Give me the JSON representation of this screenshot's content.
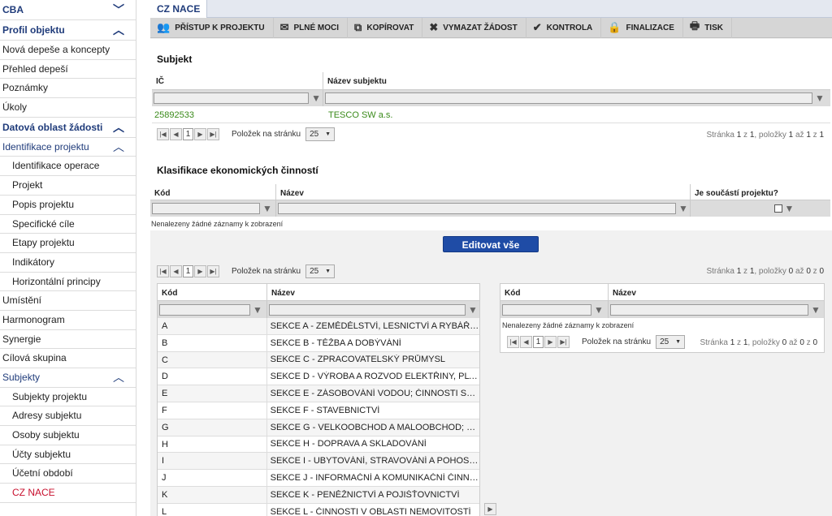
{
  "sidebar": {
    "items": [
      {
        "label": "CBA",
        "type": "header",
        "chevron": "﹀"
      },
      {
        "label": "Profil objektu",
        "type": "header",
        "chevron": "︿"
      },
      {
        "label": "Nová depeše a koncepty",
        "type": "item"
      },
      {
        "label": "Přehled depeší",
        "type": "item"
      },
      {
        "label": "Poznámky",
        "type": "item"
      },
      {
        "label": "Úkoly",
        "type": "item"
      },
      {
        "label": "Datová oblast žádosti",
        "type": "header",
        "chevron": "︿"
      },
      {
        "label": "Identifikace projektu",
        "type": "group",
        "chevron": "︿"
      },
      {
        "label": "Identifikace operace",
        "type": "sub"
      },
      {
        "label": "Projekt",
        "type": "sub"
      },
      {
        "label": "Popis projektu",
        "type": "sub"
      },
      {
        "label": "Specifické cíle",
        "type": "sub"
      },
      {
        "label": "Etapy projektu",
        "type": "sub"
      },
      {
        "label": "Indikátory",
        "type": "sub"
      },
      {
        "label": "Horizontální principy",
        "type": "sub"
      },
      {
        "label": "Umístění",
        "type": "item"
      },
      {
        "label": "Harmonogram",
        "type": "item"
      },
      {
        "label": "Synergie",
        "type": "item"
      },
      {
        "label": "Cílová skupina",
        "type": "item"
      },
      {
        "label": "Subjekty",
        "type": "group",
        "chevron": "︿"
      },
      {
        "label": "Subjekty projektu",
        "type": "sub"
      },
      {
        "label": "Adresy subjektu",
        "type": "sub"
      },
      {
        "label": "Osoby subjektu",
        "type": "sub"
      },
      {
        "label": "Účty subjektu",
        "type": "sub"
      },
      {
        "label": "Účetní období",
        "type": "sub"
      },
      {
        "label": "CZ NACE",
        "type": "sub-active"
      }
    ]
  },
  "tab": {
    "label": "CZ NACE"
  },
  "toolbar": [
    {
      "label": "PŘÍSTUP K PROJEKTU",
      "icon": "users-icon",
      "glyph": "👥"
    },
    {
      "label": "PLNÉ MOCI",
      "icon": "envelope-icon",
      "glyph": "✉"
    },
    {
      "label": "KOPÍROVAT",
      "icon": "copy-icon",
      "glyph": "⧉"
    },
    {
      "label": "VYMAZAT ŽÁDOST",
      "icon": "close-icon",
      "glyph": "✖"
    },
    {
      "label": "KONTROLA",
      "icon": "check-icon",
      "glyph": "✔"
    },
    {
      "label": "FINALIZACE",
      "icon": "lock-icon",
      "glyph": "🔒"
    },
    {
      "label": "TISK",
      "icon": "print-icon",
      "glyph": "🖶"
    }
  ],
  "subjekt": {
    "title": "Subjekt",
    "col_ic": "IČ",
    "col_name": "Název subjektu",
    "row_ic": "25892533",
    "row_name": "TESCO SW a.s.",
    "page": "1",
    "per_page_label": "Položek na stránku",
    "per_page": "25",
    "info_prefix": "Stránka ",
    "info_page": "1",
    "info_mid1": " z ",
    "info_pages": "1",
    "info_mid2": ", položky ",
    "info_from": "1",
    "info_mid3": " až ",
    "info_to": "1",
    "info_mid4": " z ",
    "info_total": "1"
  },
  "klasifikace": {
    "title": "Klasifikace ekonomických činností",
    "col_kod": "Kód",
    "col_nazev": "Název",
    "col_soucast": "Je součástí projektu?",
    "empty": "Nenalezeny žádné záznamy k zobrazení",
    "edit_button": "Editovat vše",
    "page": "1",
    "per_page_label": "Položek na stránku",
    "per_page": "25",
    "info_prefix": "Stránka ",
    "info_page": "1",
    "info_mid1": " z ",
    "info_pages": "1",
    "info_mid2": ", položky ",
    "info_from": "0",
    "info_mid3": " až ",
    "info_to": "0",
    "info_mid4": " z ",
    "info_total": "0"
  },
  "left_list": {
    "col_kod": "Kód",
    "col_nazev": "Název",
    "rows": [
      {
        "k": "A",
        "v": "SEKCE A - ZEMĚDĚLSTVÍ, LESNICTVÍ A RYBÁŘSTVÍ"
      },
      {
        "k": "B",
        "v": "SEKCE B - TĚŽBA A DOBÝVÁNÍ"
      },
      {
        "k": "C",
        "v": "SEKCE C - ZPRACOVATELSKÝ PRŮMYSL"
      },
      {
        "k": "D",
        "v": "SEKCE D - VÝROBA A ROZVOD ELEKTŘINY, PLYNU, TEPL..."
      },
      {
        "k": "E",
        "v": "SEKCE E - ZÁSOBOVÁNÍ VODOU; ČINNOSTI SOUVISEJÍCÍ..."
      },
      {
        "k": "F",
        "v": "SEKCE F - STAVEBNICTVÍ"
      },
      {
        "k": "G",
        "v": "SEKCE G - VELKOOBCHOD A MALOOBCHOD; OPRAVY A Ú..."
      },
      {
        "k": "H",
        "v": "SEKCE H - DOPRAVA A SKLADOVÁNÍ"
      },
      {
        "k": "I",
        "v": "SEKCE I - UBYTOVÁNÍ, STRAVOVÁNÍ A POHOSTINSTVÍ"
      },
      {
        "k": "J",
        "v": "SEKCE J - INFORMAČNÍ A KOMUNIKAČNÍ ČINNOSTI"
      },
      {
        "k": "K",
        "v": "SEKCE K - PENĚŽNICTVÍ A POJIŠŤOVNICTVÍ"
      },
      {
        "k": "L",
        "v": "SEKCE L - ČINNOSTI V OBLASTI NEMOVITOSTÍ"
      }
    ]
  },
  "right_list": {
    "col_kod": "Kód",
    "col_nazev": "Název",
    "empty": "Nenalezeny žádné záznamy k zobrazení",
    "page": "1",
    "per_page_label": "Položek na stránku",
    "per_page": "25",
    "info_prefix": "Stránka ",
    "info_page": "1",
    "info_mid1": " z ",
    "info_pages": "1",
    "info_mid2": ", položky ",
    "info_from": "0",
    "info_mid3": " až ",
    "info_to": "0",
    "info_mid4": " z ",
    "info_total": "0"
  },
  "move_button": "▶"
}
